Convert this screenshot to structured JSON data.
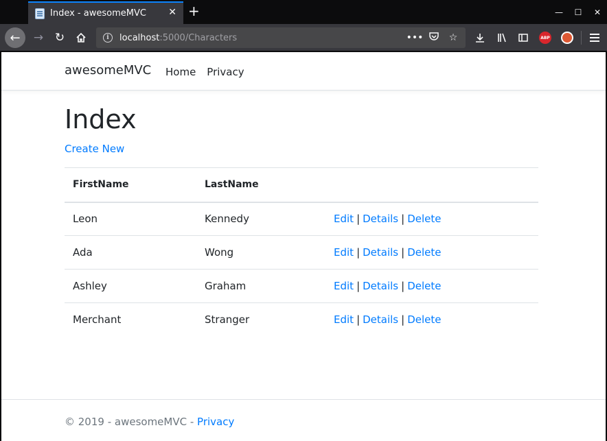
{
  "browser": {
    "tab_title": "Index - awesomeMVC",
    "tab_close": "✕",
    "new_tab": "+",
    "url_host": "localhost",
    "url_path": ":5000/Characters",
    "url_info": "i",
    "icons": {
      "back": "back-arrow-icon",
      "forward": "forward-arrow-icon",
      "reload": "reload-icon",
      "home": "home-icon",
      "page_actions": "more-icon",
      "pocket": "pocket-icon",
      "bookmark": "star-icon",
      "downloads": "download-icon",
      "library": "library-icon",
      "sidebar": "sidebar-icon",
      "adblock": "adblock-plus-icon",
      "duckduckgo": "duckduckgo-icon",
      "menu": "hamburger-menu-icon"
    },
    "adblock_label": "ABP",
    "window_controls": {
      "minimize": "—",
      "maximize": "☐",
      "close": "✕"
    },
    "accent_color": "#0a84ff"
  },
  "site": {
    "brand": "awesomeMVC",
    "nav": [
      {
        "label": "Home"
      },
      {
        "label": "Privacy"
      }
    ],
    "link_color": "#007bff"
  },
  "main": {
    "title": "Index",
    "create_new": "Create New",
    "table": {
      "headers": [
        "FirstName",
        "LastName",
        ""
      ],
      "rows": [
        {
          "first": "Leon",
          "last": "Kennedy"
        },
        {
          "first": "Ada",
          "last": "Wong"
        },
        {
          "first": "Ashley",
          "last": "Graham"
        },
        {
          "first": "Merchant",
          "last": "Stranger"
        }
      ],
      "actions": {
        "edit": "Edit",
        "details": "Details",
        "delete": "Delete",
        "separator": "|"
      }
    }
  },
  "footer": {
    "copyright": "© 2019 - awesomeMVC - ",
    "privacy": "Privacy"
  }
}
